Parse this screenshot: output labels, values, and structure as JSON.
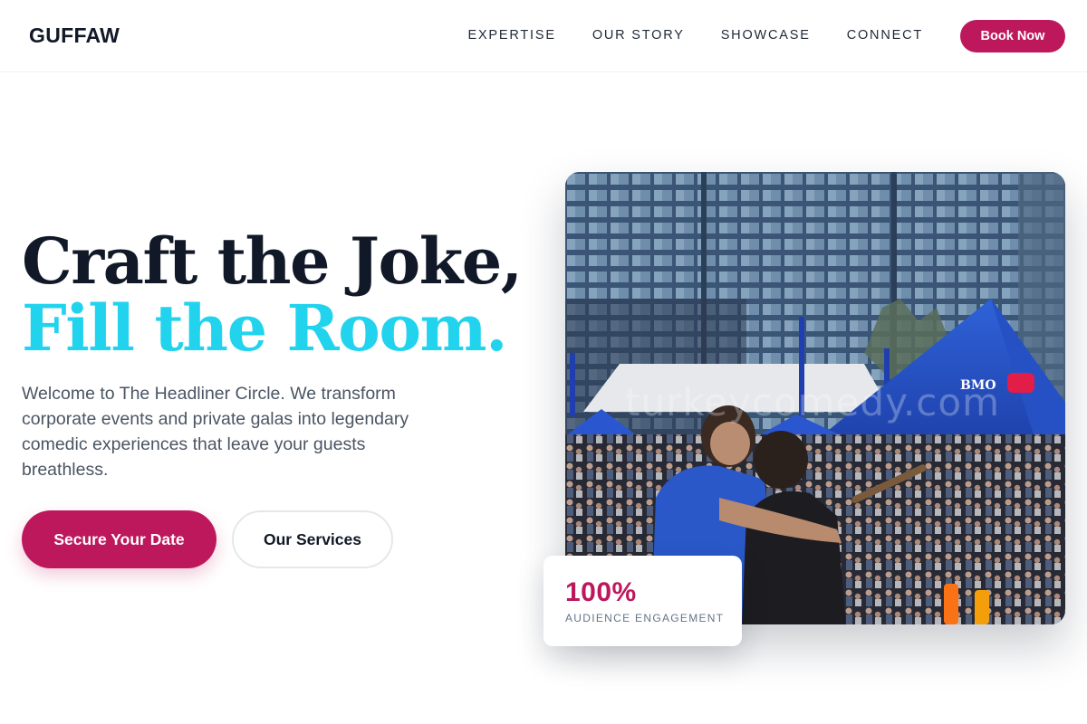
{
  "header": {
    "brand": "GUFFAW",
    "nav": [
      "EXPERTISE",
      "OUR STORY",
      "SHOWCASE",
      "CONNECT"
    ],
    "cta_label": "Book Now"
  },
  "hero": {
    "title_line1": "Craft the Joke,",
    "title_line2": "Fill the Room.",
    "description": "Welcome to The Headliner Circle. We transform corporate events and private galas into legendary comedic experiences that leave your guests breathless.",
    "primary_button": "Secure Your Date",
    "secondary_button": "Our Services"
  },
  "photo": {
    "watermark": "turkeycomedy.com",
    "tent_sign": "BMO"
  },
  "stat": {
    "value": "100%",
    "label": "AUDIENCE ENGAGEMENT"
  },
  "colors": {
    "accent": "#be185d",
    "highlight": "#22d3ee",
    "heading": "#111827",
    "body_text": "#4b5563"
  },
  "icons": []
}
